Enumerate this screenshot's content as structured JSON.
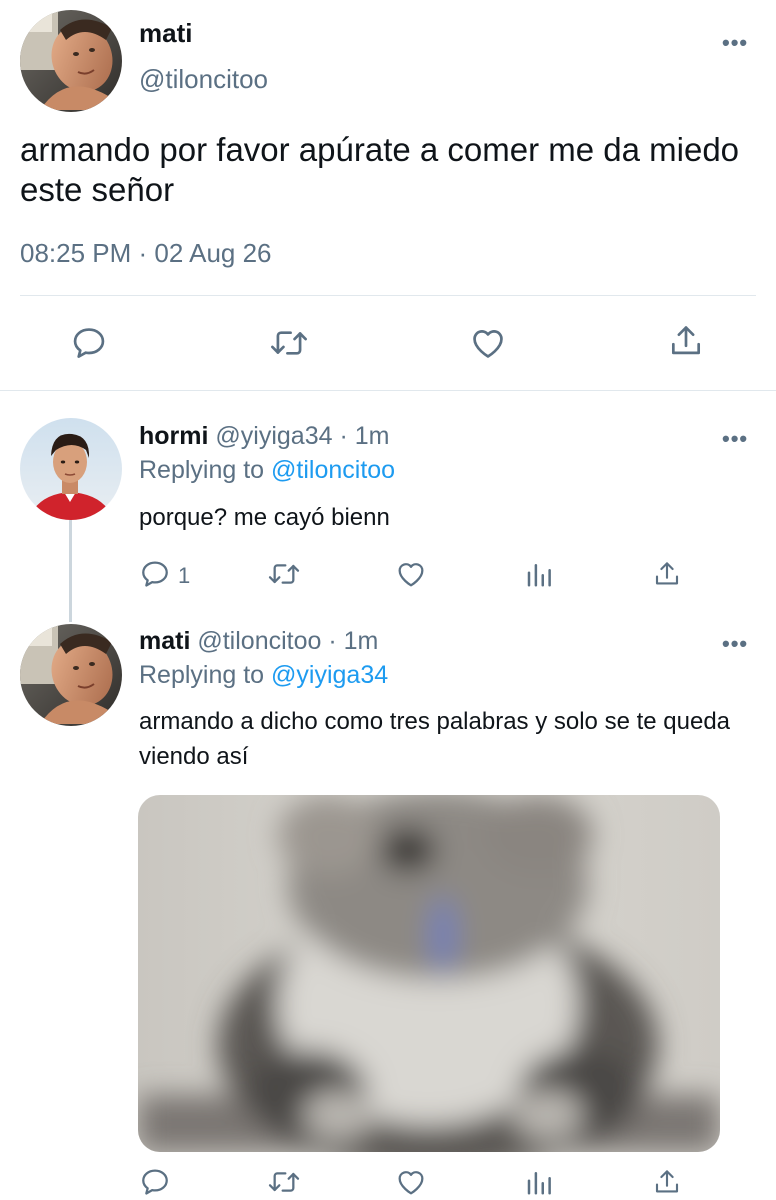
{
  "main_tweet": {
    "author_name": "mati",
    "author_handle": "@tiloncitoo",
    "text": "armando por favor apúrate a comer me da miedo este señor",
    "timestamp": "08:25 PM · 02 Aug 26",
    "actions": [
      "reply-icon",
      "retweet-icon",
      "like-icon",
      "share-icon"
    ]
  },
  "replies": [
    {
      "author_name": "hormi",
      "author_handle": "@yiyiga34",
      "separator": "·",
      "time": "1m",
      "replying_prefix": "Replying to",
      "replying_to": "@tiloncitoo",
      "text": "porque? me cayó bienn",
      "reply_count": "1"
    },
    {
      "author_name": "mati",
      "author_handle": "@tiloncitoo",
      "separator": "·",
      "time": "1m",
      "replying_prefix": "Replying to",
      "replying_to": "@yiyiga34",
      "text": "armando a dicho como tres palabras y solo se te queda viendo así"
    }
  ],
  "colors": {
    "text": "#0f1419",
    "secondary": "#5b7083",
    "link": "#1d9bf0",
    "divider": "#e1e8ed"
  }
}
